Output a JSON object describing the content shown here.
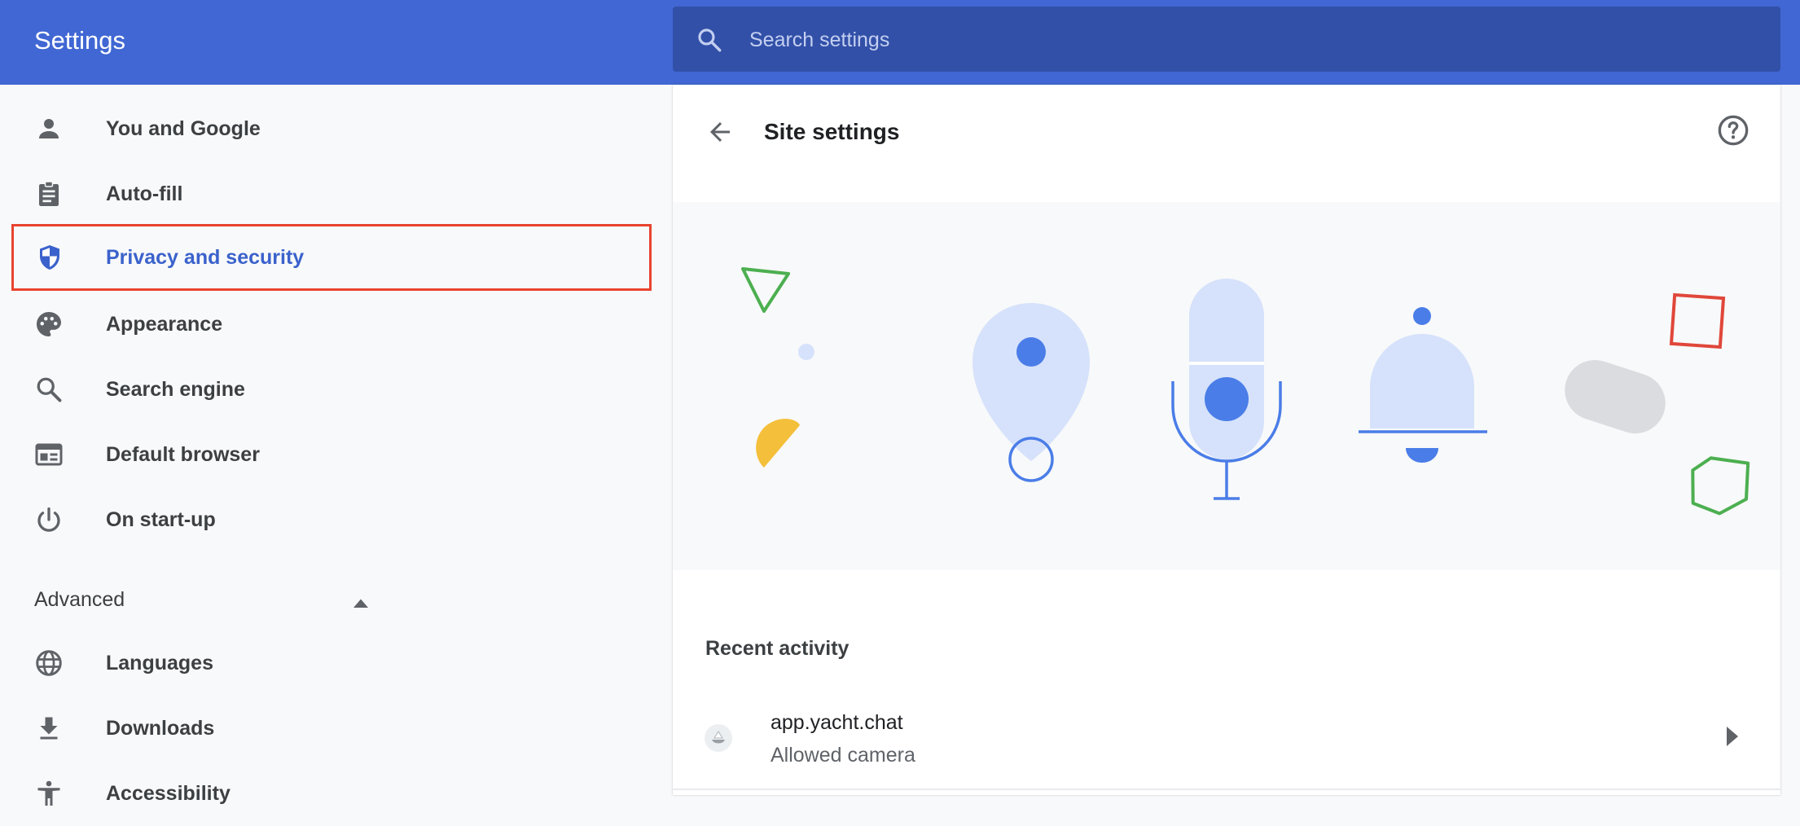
{
  "header": {
    "title": "Settings",
    "search_placeholder": "Search settings",
    "colors": {
      "bar": "#4067d3",
      "search_bg": "#3250a8"
    }
  },
  "sidebar": {
    "items": [
      {
        "label": "You and Google",
        "icon": "person-icon"
      },
      {
        "label": "Auto-fill",
        "icon": "clipboard-icon"
      },
      {
        "label": "Privacy and security",
        "icon": "shield-icon",
        "active": true
      },
      {
        "label": "Appearance",
        "icon": "palette-icon"
      },
      {
        "label": "Search engine",
        "icon": "search-icon"
      },
      {
        "label": "Default browser",
        "icon": "browser-window-icon"
      },
      {
        "label": "On start-up",
        "icon": "power-icon"
      }
    ],
    "advanced": {
      "label": "Advanced",
      "expanded": true,
      "items": [
        {
          "label": "Languages",
          "icon": "globe-icon"
        },
        {
          "label": "Downloads",
          "icon": "download-icon"
        },
        {
          "label": "Accessibility",
          "icon": "accessibility-icon"
        }
      ]
    },
    "colors": {
      "active_text": "#3b62cc",
      "highlight_border": "#e8432f"
    }
  },
  "main": {
    "title": "Site settings",
    "recent_activity": {
      "title": "Recent activity",
      "items": [
        {
          "site": "app.yacht.chat",
          "detail": "Allowed camera"
        }
      ]
    }
  }
}
